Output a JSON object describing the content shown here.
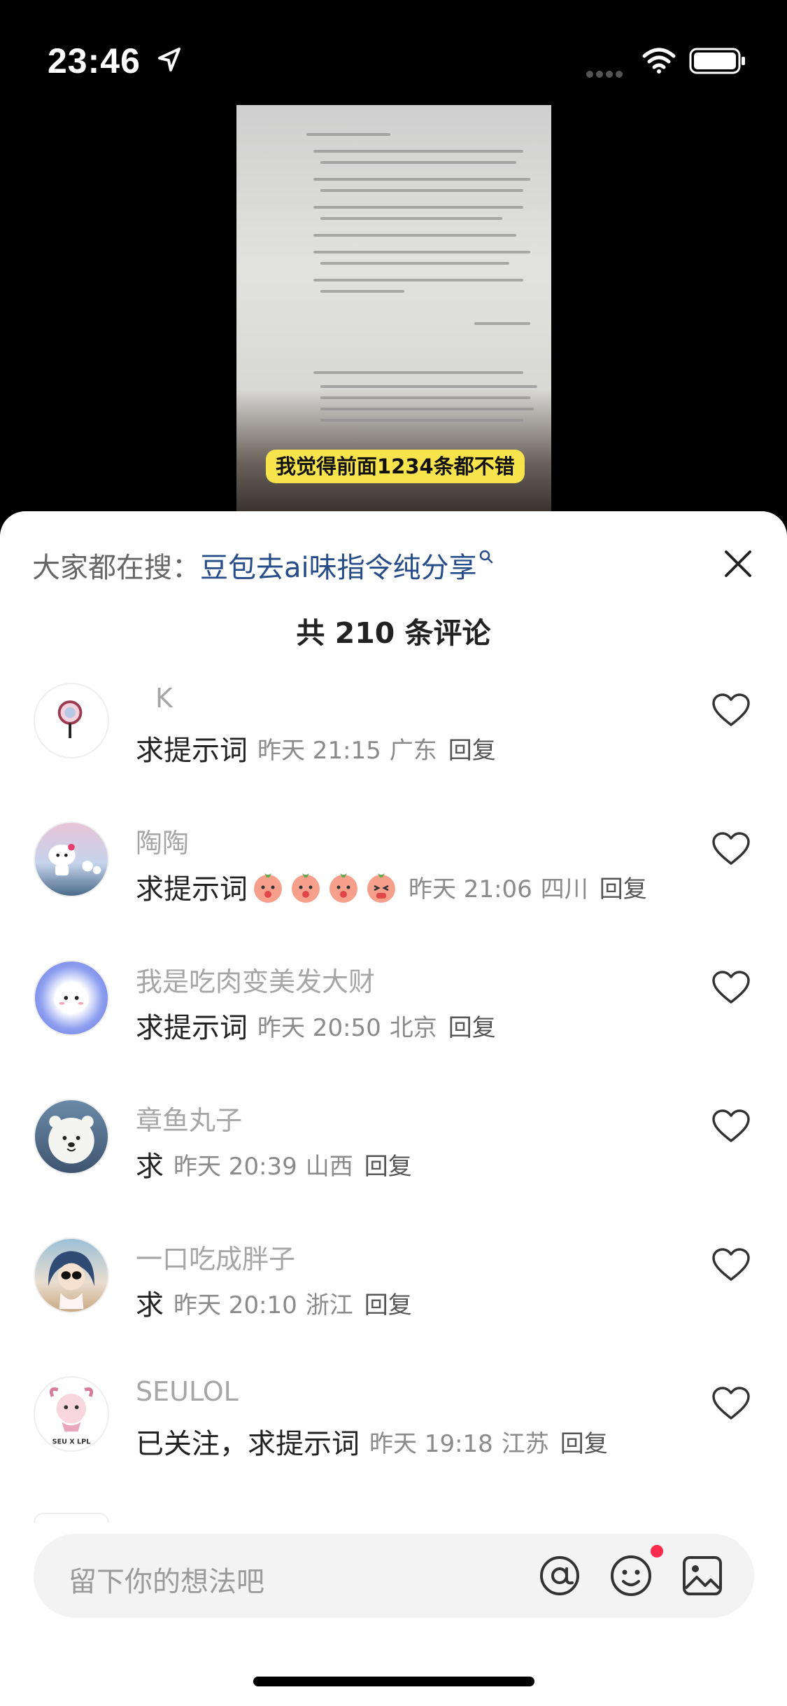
{
  "status_bar": {
    "time": "23:46",
    "icons": [
      "location-arrow-icon",
      "signal-icon",
      "wifi-icon",
      "battery-icon"
    ]
  },
  "video": {
    "caption": "我觉得前面1234条都不错"
  },
  "search": {
    "prefix": "大家都在搜：",
    "term": "豆包去ai味指令纯分享",
    "icon": "search-q-icon"
  },
  "comments_header": {
    "count_label": "共 210 条评论"
  },
  "comments": [
    {
      "nickname": "K",
      "text": "求提示词",
      "emoji_count": 0,
      "time": "昨天 21:15",
      "location": "广东",
      "reply": "回复"
    },
    {
      "nickname": "陶陶",
      "text": "求提示词",
      "emoji_count": 4,
      "time": "昨天 21:06",
      "location": "四川",
      "reply": "回复"
    },
    {
      "nickname": "我是吃肉变美发大财",
      "text": "求提示词",
      "emoji_count": 0,
      "time": "昨天 20:50",
      "location": "北京",
      "reply": "回复"
    },
    {
      "nickname": "章鱼丸子",
      "text": "求",
      "emoji_count": 0,
      "time": "昨天 20:39",
      "location": "山西",
      "reply": "回复"
    },
    {
      "nickname": "一口吃成胖子",
      "text": "求",
      "emoji_count": 0,
      "time": "昨天 20:10",
      "location": "浙江",
      "reply": "回复"
    },
    {
      "nickname": "SEULOL",
      "text": "已关注，求提示词",
      "emoji_count": 0,
      "time": "昨天 19:18",
      "location": "江苏",
      "reply": "回复"
    }
  ],
  "avatar_badges": {
    "seulol": "SEU X LPL"
  },
  "input_bar": {
    "placeholder": "留下你的想法吧"
  },
  "colors": {
    "link": "#274c8a",
    "caption_bg": "#f7e34b",
    "notification_dot": "#ff2b4f"
  }
}
